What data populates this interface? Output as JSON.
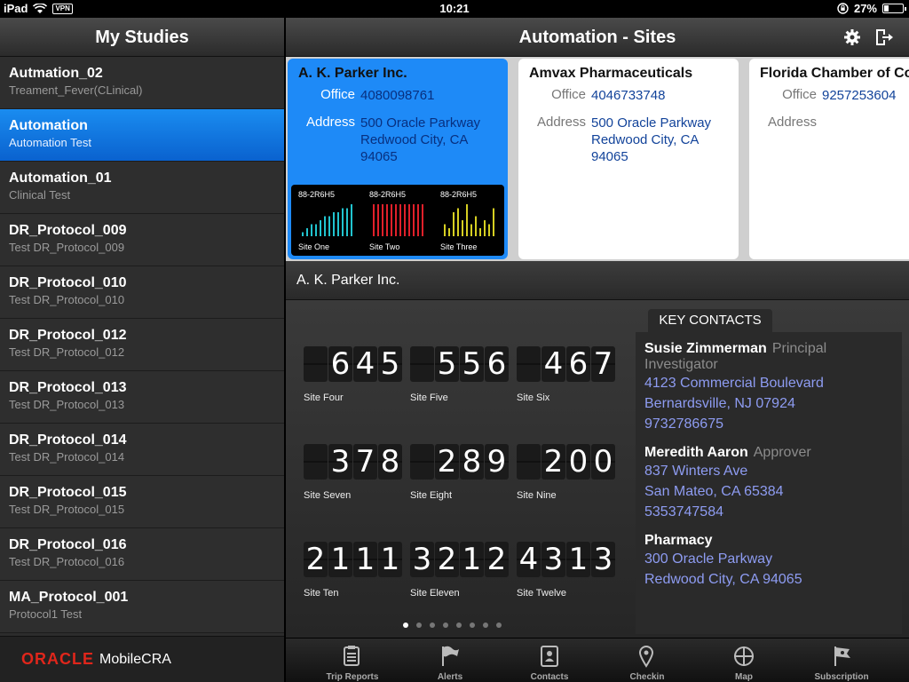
{
  "status": {
    "device": "iPad",
    "vpn": "VPN",
    "time": "10:21",
    "battery": "27%",
    "battery_level": 0.27
  },
  "left": {
    "title": "My Studies",
    "studies": [
      {
        "title": "Autmation_02",
        "subtitle": "Treament_Fever(CLinical)"
      },
      {
        "title": "Automation",
        "subtitle": "Automation Test"
      },
      {
        "title": "Automation_01",
        "subtitle": "Clinical Test"
      },
      {
        "title": "DR_Protocol_009",
        "subtitle": "Test DR_Protocol_009"
      },
      {
        "title": "DR_Protocol_010",
        "subtitle": "Test DR_Protocol_010"
      },
      {
        "title": "DR_Protocol_012",
        "subtitle": "Test DR_Protocol_012"
      },
      {
        "title": "DR_Protocol_013",
        "subtitle": "Test DR_Protocol_013"
      },
      {
        "title": "DR_Protocol_014",
        "subtitle": "Test DR_Protocol_014"
      },
      {
        "title": "DR_Protocol_015",
        "subtitle": "Test DR_Protocol_015"
      },
      {
        "title": "DR_Protocol_016",
        "subtitle": "Test DR_Protocol_016"
      },
      {
        "title": "MA_Protocol_001",
        "subtitle": "Protocol1 Test"
      }
    ],
    "footer": {
      "brand": "ORACLE",
      "product": "MobileCRA"
    }
  },
  "header": {
    "title": "Automation - Sites",
    "settings_icon": "gear-icon",
    "logout_icon": "logout-icon"
  },
  "sites": [
    {
      "name": "A. K. Parker Inc.",
      "office_label": "Office",
      "office": "4080098761",
      "address_label": "Address",
      "address_lines": [
        "500 Oracle Parkway",
        "Redwood City, CA",
        "94065"
      ]
    },
    {
      "name": "Amvax Pharmaceuticals",
      "office_label": "Office",
      "office": "4046733748",
      "address_label": "Address",
      "address_lines": [
        "500 Oracle Parkway",
        "Redwood City, CA",
        "94065"
      ]
    },
    {
      "name": "Florida Chamber of Com",
      "office_label": "Office",
      "office": "9257253604",
      "address_label": "Address",
      "address_lines": [
        "",
        "",
        ""
      ]
    }
  ],
  "mini_charts": [
    {
      "id": "88-2R6H5",
      "label": "Site One",
      "color": "#21c4cf",
      "values": [
        1,
        2,
        3,
        3,
        4,
        5,
        5,
        6,
        6,
        7,
        7,
        8
      ]
    },
    {
      "id": "88-2R6H5",
      "label": "Site Two",
      "color": "#e0202a",
      "values": [
        8,
        8,
        8,
        8,
        8,
        8,
        8,
        8,
        8,
        8,
        8,
        8
      ]
    },
    {
      "id": "88-2R6H5",
      "label": "Site Three",
      "color": "#d6cf22",
      "values": [
        3,
        2,
        6,
        7,
        4,
        8,
        3,
        5,
        2,
        4,
        3,
        7
      ]
    }
  ],
  "selected_site": "A. K. Parker Inc.",
  "counters": [
    {
      "digits": [
        "",
        "6",
        "4",
        "5"
      ],
      "label": "Site Four"
    },
    {
      "digits": [
        "",
        "5",
        "5",
        "6"
      ],
      "label": "Site Five"
    },
    {
      "digits": [
        "",
        "4",
        "6",
        "7"
      ],
      "label": "Site Six"
    },
    {
      "digits": [
        "",
        "3",
        "7",
        "8"
      ],
      "label": "Site Seven"
    },
    {
      "digits": [
        "",
        "2",
        "8",
        "9"
      ],
      "label": "Site Eight"
    },
    {
      "digits": [
        "",
        "2",
        "0",
        "0"
      ],
      "label": "Site Nine"
    },
    {
      "digits": [
        "2",
        "1",
        "1",
        "1"
      ],
      "label": "Site Ten"
    },
    {
      "digits": [
        "3",
        "2",
        "1",
        "2"
      ],
      "label": "Site Eleven"
    },
    {
      "digits": [
        "4",
        "3",
        "1",
        "3"
      ],
      "label": "Site Twelve"
    }
  ],
  "pager": {
    "count": 8,
    "active": 0
  },
  "key_contacts": {
    "title": "KEY CONTACTS",
    "contacts": [
      {
        "name": "Susie Zimmerman",
        "role": "Principal Investigator",
        "lines": [
          "4123 Commercial Boulevard",
          "Bernardsville, NJ 07924",
          "9732786675"
        ]
      },
      {
        "name": "Meredith Aaron",
        "role": "Approver",
        "lines": [
          "837 Winters Ave",
          "San Mateo, CA 65384",
          "5353747584"
        ]
      },
      {
        "name": "Pharmacy",
        "role": "",
        "lines": [
          "300 Oracle Parkway",
          "Redwood City, CA 94065"
        ]
      }
    ]
  },
  "tabs": [
    {
      "label": "Trip Reports",
      "icon": "clipboard-icon"
    },
    {
      "label": "Alerts",
      "icon": "flag-icon"
    },
    {
      "label": "Contacts",
      "icon": "address-book-icon"
    },
    {
      "label": "Checkin",
      "icon": "location-pin-icon"
    },
    {
      "label": "Map",
      "icon": "crosshair-icon"
    },
    {
      "label": "Subscription",
      "icon": "subscription-flag-icon"
    }
  ]
}
